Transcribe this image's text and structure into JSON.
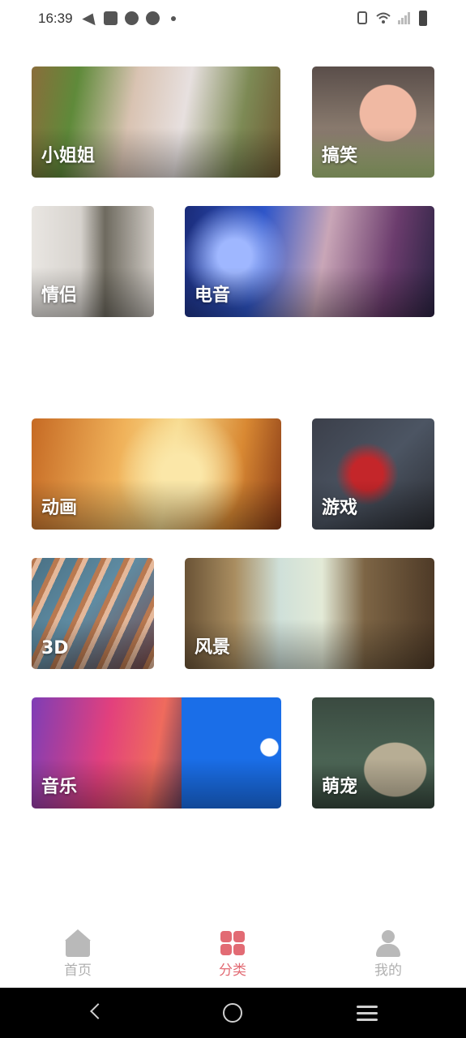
{
  "status_bar": {
    "time": "16:39",
    "icons": [
      "telegram-icon",
      "shopping-bag-icon",
      "dial-icon",
      "dial-icon",
      "dot-icon",
      "vibrate-icon",
      "wifi-icon",
      "signal-icon",
      "battery-icon"
    ]
  },
  "categories": [
    {
      "label": "小姐姐"
    },
    {
      "label": "搞笑"
    },
    {
      "label": "情侣"
    },
    {
      "label": "电音"
    },
    {
      "label": "动画"
    },
    {
      "label": "游戏"
    },
    {
      "label": "3D"
    },
    {
      "label": "风景"
    },
    {
      "label": "音乐"
    },
    {
      "label": "萌宠"
    }
  ],
  "bottom_nav": {
    "home": {
      "label": "首页",
      "icon": "home-icon",
      "color": "#b0b0b0"
    },
    "category": {
      "label": "分类",
      "icon": "grid-icon",
      "color": "#e26b74",
      "active": true
    },
    "mine": {
      "label": "我的",
      "icon": "user-icon",
      "color": "#b0b0b0"
    }
  },
  "system_nav": {
    "icons": [
      "back-icon",
      "home-circle-icon",
      "menu-icon"
    ]
  }
}
